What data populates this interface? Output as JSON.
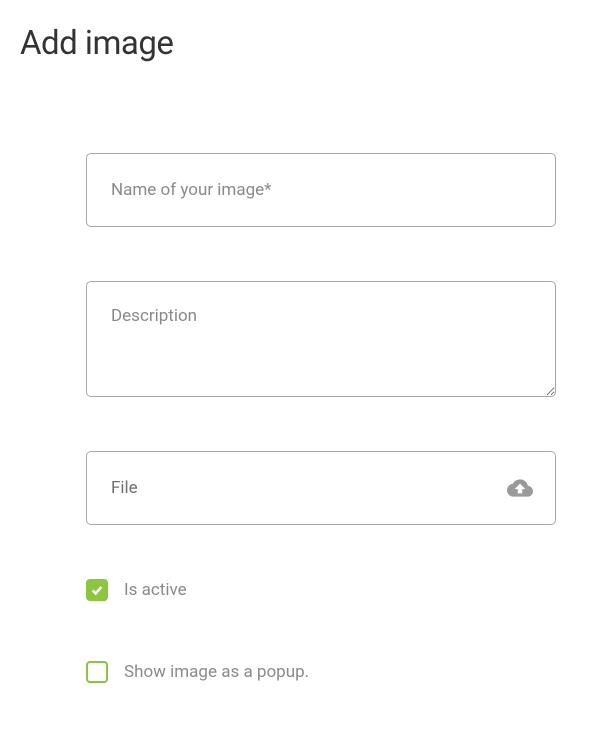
{
  "header": {
    "title": "Add image"
  },
  "form": {
    "name": {
      "placeholder": "Name of your image*",
      "value": ""
    },
    "description": {
      "placeholder": "Description",
      "value": ""
    },
    "file": {
      "label": "File"
    },
    "is_active": {
      "label": "Is active",
      "checked": true
    },
    "show_popup": {
      "label": "Show image as a popup.",
      "checked": false
    }
  }
}
